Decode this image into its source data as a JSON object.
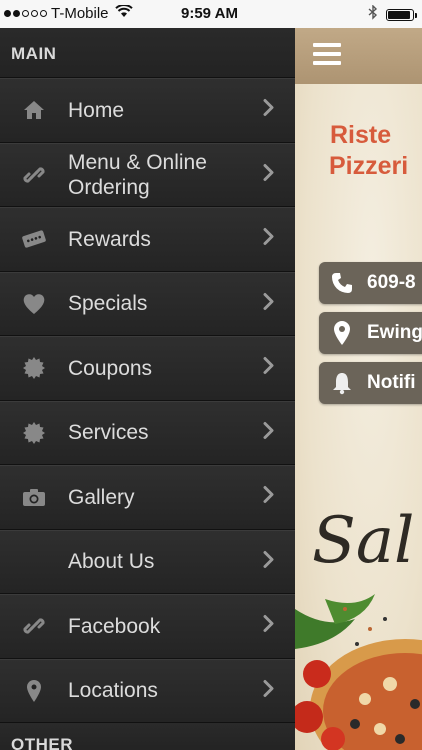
{
  "status_bar": {
    "carrier": "T-Mobile",
    "time": "9:59 AM",
    "signal_bars_filled": 2,
    "signal_bars_total": 5,
    "battery_level_percent": 90
  },
  "drawer": {
    "main_header": "MAIN",
    "other_header": "OTHER",
    "items": [
      {
        "label": "Home",
        "icon": "home-icon"
      },
      {
        "label": "Menu & Online Ordering",
        "icon": "link-icon"
      },
      {
        "label": "Rewards",
        "icon": "ticket-icon"
      },
      {
        "label": "Specials",
        "icon": "heart-icon"
      },
      {
        "label": "Coupons",
        "icon": "badge-icon"
      },
      {
        "label": "Services",
        "icon": "badge-icon"
      },
      {
        "label": "Gallery",
        "icon": "camera-icon"
      },
      {
        "label": "About Us",
        "icon": ""
      },
      {
        "label": "Facebook",
        "icon": "link-icon"
      },
      {
        "label": "Locations",
        "icon": "pin-icon"
      }
    ]
  },
  "content": {
    "title_line1": "Riste",
    "title_line2": "Pizzeri",
    "phone": "609-8",
    "location": "Ewing",
    "notifications": "Notifi",
    "script_text": "Sal",
    "colors": {
      "accent_red": "#d75b3c",
      "pill_bg": "#6b6459",
      "drawer_bg": "#222222"
    }
  }
}
